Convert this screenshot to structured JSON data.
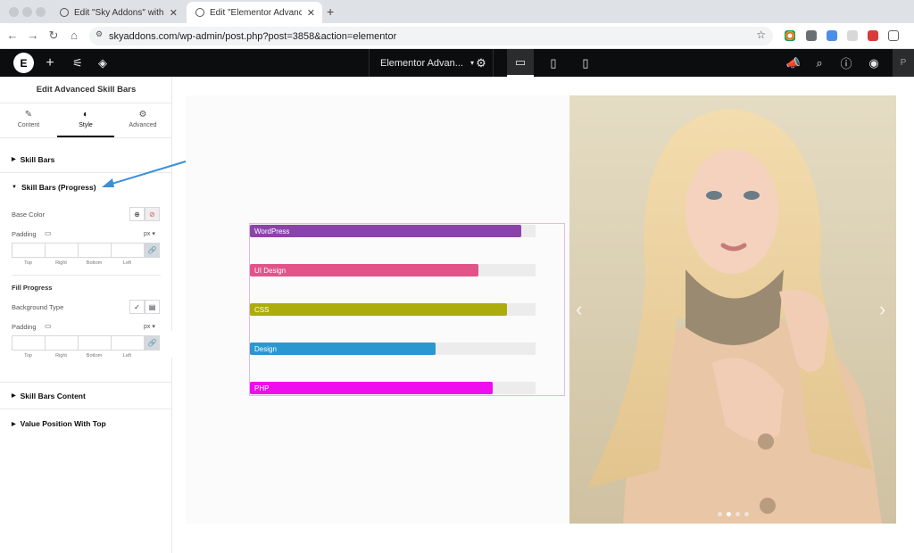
{
  "browser": {
    "tabs": [
      {
        "title": "Edit \"Sky Addons\" with Eleme"
      },
      {
        "title": "Edit \"Elementor Advanced Sk"
      }
    ],
    "new_tab": "+",
    "url": "skyaddons.com/wp-admin/post.php?post=3858&action=elementor"
  },
  "topbar": {
    "logo": "E",
    "document_name": "Elementor Advan...",
    "right_cut": "P"
  },
  "panel": {
    "title": "Edit Advanced Skill Bars",
    "tabs": [
      "Content",
      "Style",
      "Advanced"
    ],
    "sections": {
      "skill_bars": "Skill Bars",
      "progress": "Skill Bars (Progress)",
      "content": "Skill Bars Content",
      "value_position": "Value Position With Top"
    },
    "base_color": "Base Color",
    "padding": "Padding",
    "unit": "px",
    "dims": [
      "Top",
      "Right",
      "Bottom",
      "Left"
    ],
    "fill_progress": "Fill Progress",
    "background_type": "Background Type"
  },
  "skill_bars": [
    {
      "label": "WordPress",
      "value": 95,
      "color": "#8a44a8"
    },
    {
      "label": "UI Design",
      "value": 80,
      "color": "#e2538a"
    },
    {
      "label": "CSS",
      "value": 90,
      "color": "#acac0c"
    },
    {
      "label": "Design",
      "value": 65,
      "color": "#2a98d0"
    },
    {
      "label": "PHP",
      "value": 85,
      "color": "#ef0cef"
    }
  ],
  "colors": {
    "accent": "#0c0d0e",
    "arrow": "#3a8fd8"
  }
}
